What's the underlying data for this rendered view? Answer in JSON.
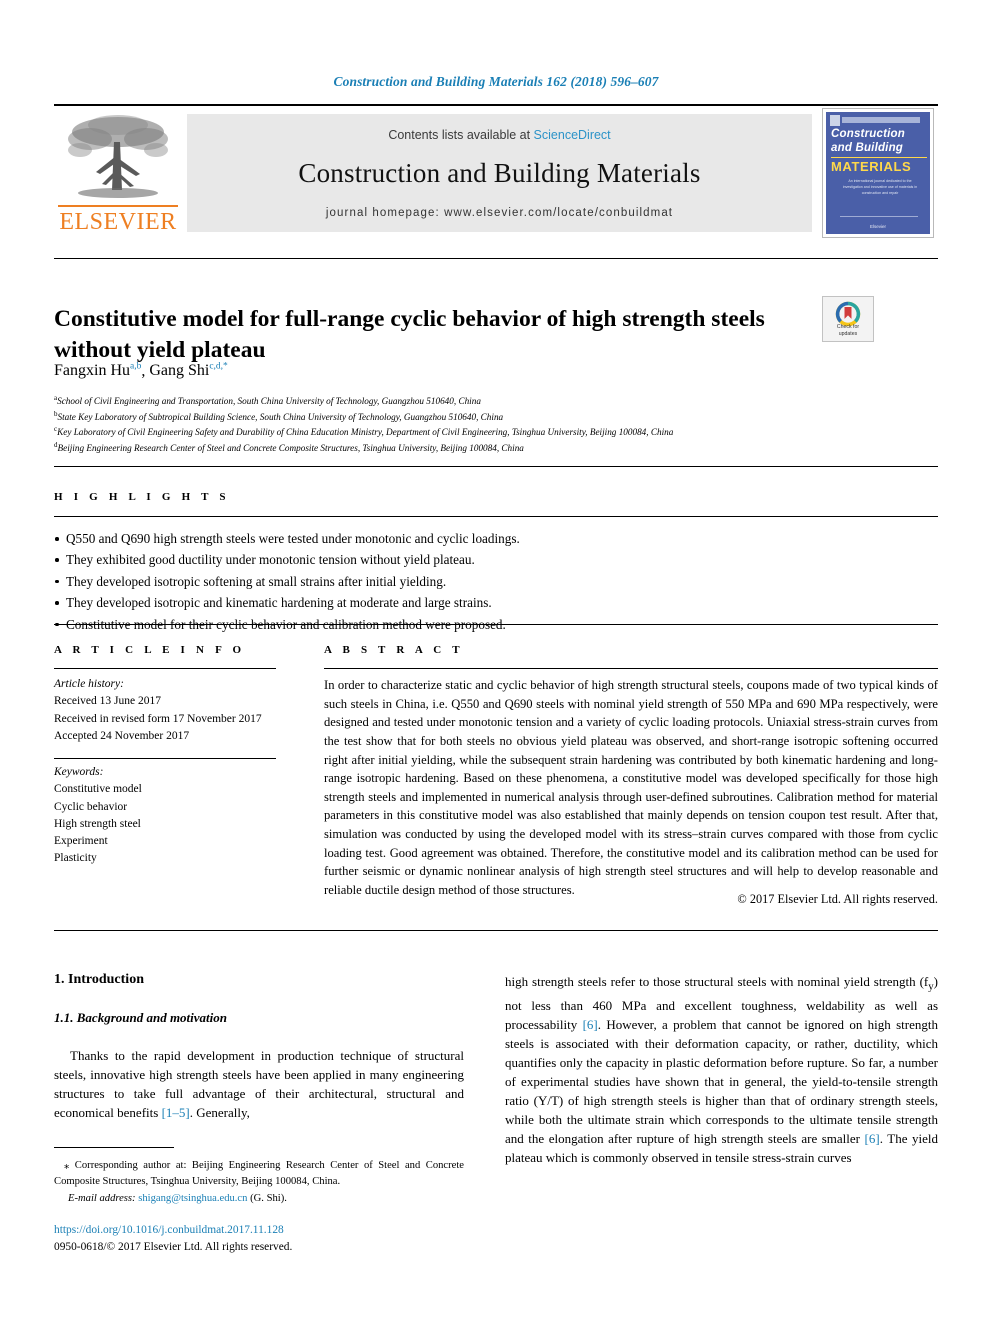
{
  "running_head": "Construction and Building Materials 162 (2018) 596–607",
  "masthead": {
    "contents_prefix": "Contents lists available at ",
    "sciencedirect": "ScienceDirect",
    "journal_title": "Construction and Building Materials",
    "homepage": "journal homepage: www.elsevier.com/locate/conbuildmat",
    "publisher_wordmark": "ELSEVIER",
    "cover": {
      "line1": "Construction",
      "line2": "and Building",
      "line3": "MATERIALS",
      "blurb": "An international journal dedicated to the investigation and innovative use of materials in construction and repair",
      "publisher": "Elsevier"
    },
    "accent_blue": "#2b93c8",
    "elsevier_orange": "#ee7f22"
  },
  "article": {
    "title": "Constitutive model for full-range cyclic behavior of high strength steels without yield plateau",
    "crossmark_line1": "Check for",
    "crossmark_line2": "updates",
    "authors": [
      {
        "name": "Fangxin Hu",
        "sup": "a,b"
      },
      {
        "name": "Gang Shi",
        "sup": "c,d,*"
      }
    ],
    "affiliations": [
      {
        "marker": "a",
        "text": "School of Civil Engineering and Transportation, South China University of Technology, Guangzhou 510640, China"
      },
      {
        "marker": "b",
        "text": "State Key Laboratory of Subtropical Building Science, South China University of Technology, Guangzhou 510640, China"
      },
      {
        "marker": "c",
        "text": "Key Laboratory of Civil Engineering Safety and Durability of China Education Ministry, Department of Civil Engineering, Tsinghua University, Beijing 100084, China"
      },
      {
        "marker": "d",
        "text": "Beijing Engineering Research Center of Steel and Concrete Composite Structures, Tsinghua University, Beijing 100084, China"
      }
    ]
  },
  "highlights": {
    "heading": "H I G H L I G H T S",
    "items": [
      "Q550 and Q690 high strength steels were tested under monotonic and cyclic loadings.",
      "They exhibited good ductility under monotonic tension without yield plateau.",
      "They developed isotropic softening at small strains after initial yielding.",
      "They developed isotropic and kinematic hardening at moderate and large strains.",
      "Constitutive model for their cyclic behavior and calibration method were proposed."
    ]
  },
  "article_info": {
    "heading": "A R T I C L E   I N F O",
    "history_label": "Article history:",
    "history": [
      "Received 13 June 2017",
      "Received in revised form 17 November 2017",
      "Accepted 24 November 2017"
    ],
    "keywords_label": "Keywords:",
    "keywords": [
      "Constitutive model",
      "Cyclic behavior",
      "High strength steel",
      "Experiment",
      "Plasticity"
    ]
  },
  "abstract": {
    "heading": "A B S T R A C T",
    "text": "In order to characterize static and cyclic behavior of high strength structural steels, coupons made of two typical kinds of such steels in China, i.e. Q550 and Q690 steels with nominal yield strength of 550 MPa and 690 MPa respectively, were designed and tested under monotonic tension and a variety of cyclic loading protocols. Uniaxial stress-strain curves from the test show that for both steels no obvious yield plateau was observed, and short-range isotropic softening occurred right after initial yielding, while the subsequent strain hardening was contributed by both kinematic hardening and long-range isotropic hardening. Based on these phenomena, a constitutive model was developed specifically for those high strength steels and implemented in numerical analysis through user-defined subroutines. Calibration method for material parameters in this constitutive model was also established that mainly depends on tension coupon test result. After that, simulation was conducted by using the developed model with its stress–strain curves compared with those from cyclic loading test. Good agreement was obtained. Therefore, the constitutive model and its calibration method can be used for further seismic or dynamic nonlinear analysis of high strength steel structures and will help to develop reasonable and reliable ductile design method of those structures.",
    "copyright": "© 2017 Elsevier Ltd. All rights reserved."
  },
  "body": {
    "section_number_title": "1. Introduction",
    "subsection_title": "1.1. Background and motivation",
    "left_paragraph_1": "Thanks to the rapid development in production technique of structural steels, innovative high strength steels have been applied in many engineering structures to take full advantage of their architectural, structural and economical benefits ",
    "left_ref_1": "[1–5]",
    "left_paragraph_1_end": ". Generally,",
    "right_paragraph_a": "high strength steels refer to those structural steels with nominal yield strength (f",
    "right_paragraph_a_sub": "y",
    "right_paragraph_b": ") not less than 460 MPa and excellent toughness, weldability as well as processability ",
    "right_ref_1": "[6]",
    "right_paragraph_c": ". However, a problem that cannot be ignored on high strength steels is associated with their deformation capacity, or rather, ductility, which quantifies only the capacity in plastic deformation before rupture. So far, a number of experimental studies have shown that in general, the yield-to-tensile strength ratio (Y/T) of high strength steels is higher than that of ordinary strength steels, while both the ultimate strain which corresponds to the ultimate tensile strength and the elongation after rupture of high strength steels are smaller ",
    "right_ref_2": "[6]",
    "right_paragraph_d": ". The yield plateau which is commonly observed in tensile stress-strain curves"
  },
  "footnote": {
    "corresponding": "⁎ Corresponding author at: Beijing Engineering Research Center of Steel and Concrete Composite Structures, Tsinghua University, Beijing 100084, China.",
    "email_label": "E-mail address:",
    "email": "shigang@tsinghua.edu.cn",
    "email_owner": "(G. Shi).",
    "doi": "https://doi.org/10.1016/j.conbuildmat.2017.11.128",
    "issn_line": "0950-0618/© 2017 Elsevier Ltd. All rights reserved."
  }
}
